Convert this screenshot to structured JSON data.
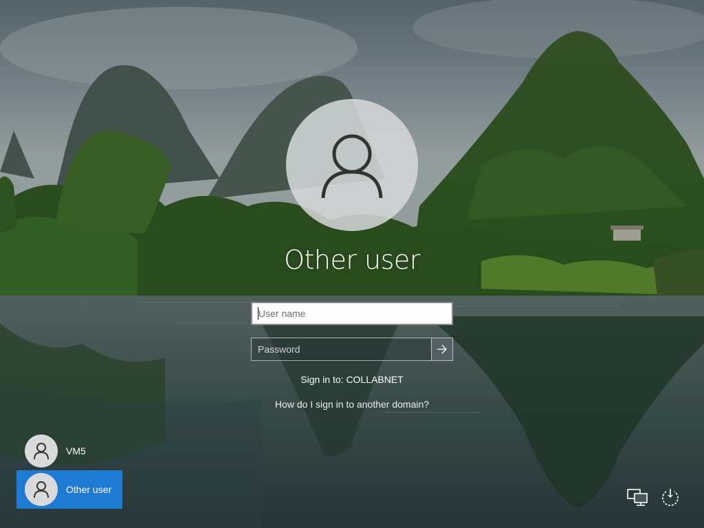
{
  "login": {
    "selected_user": "Other user",
    "username_placeholder": "User name",
    "password_placeholder": "Password",
    "sign_in_to": "Sign in to: COLLABNET",
    "domain_help_link": "How do I sign in to another domain?"
  },
  "user_list": [
    {
      "name": "VM5",
      "selected": false
    },
    {
      "name": "Other user",
      "selected": true
    }
  ],
  "system_icons": [
    "network-icon",
    "power-icon"
  ],
  "colors": {
    "selected_tile": "#1f7ad1",
    "avatar_bg": "#d9dadb",
    "text": "#ffffff"
  }
}
